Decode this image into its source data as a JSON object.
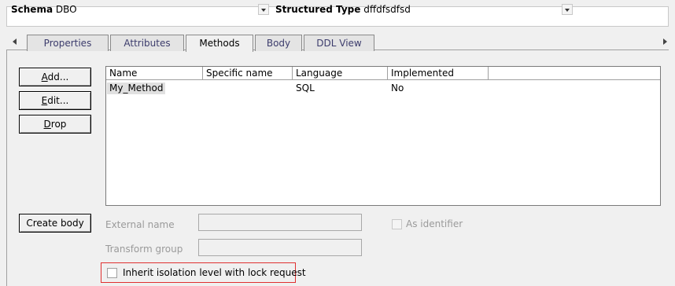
{
  "header": {
    "schema_label": "Schema",
    "schema_value": "DBO",
    "type_label": "Structured Type",
    "type_value": "dffdfsdfsd"
  },
  "tabs": [
    {
      "label": "Properties",
      "active": false
    },
    {
      "label": "Attributes",
      "active": false
    },
    {
      "label": "Methods",
      "active": true
    },
    {
      "label": "Body",
      "active": false
    },
    {
      "label": "DDL View",
      "active": false
    }
  ],
  "buttons": {
    "add_rest": "dd...",
    "add_mnemonic": "A",
    "edit_rest": "dit...",
    "edit_mnemonic": "E",
    "drop_rest": "rop",
    "drop_mnemonic": "D",
    "create_body": "Create body"
  },
  "methods_table": {
    "columns": [
      "Name",
      "Specific name",
      "Language",
      "Implemented"
    ],
    "rows": [
      {
        "name": "My_Method",
        "specific_name": "",
        "language": "SQL",
        "implemented": "No"
      }
    ]
  },
  "form": {
    "external_name_label": "External name",
    "external_name_value": "",
    "transform_group_label": "Transform group",
    "transform_group_value": "",
    "as_identifier_label": "As identifier",
    "as_identifier_checked": false,
    "inherit_isolation_label": "Inherit isolation level with lock request",
    "inherit_isolation_checked": false
  },
  "colors": {
    "highlight_border": "#e03030",
    "panel_bg": "#f0f0f0"
  }
}
